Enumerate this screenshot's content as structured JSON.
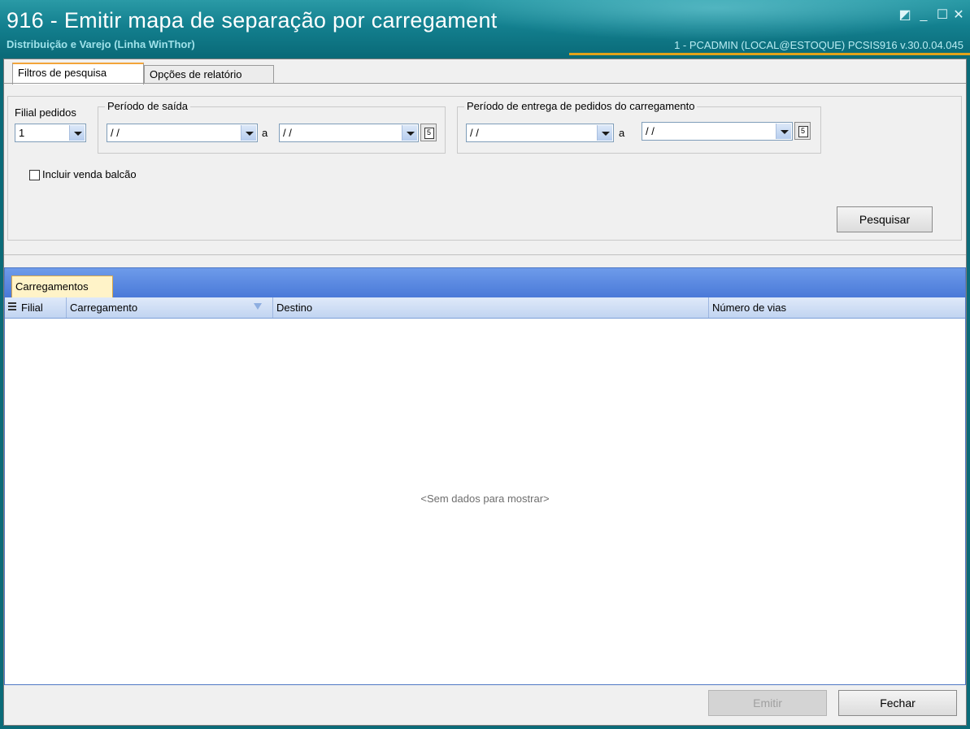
{
  "window": {
    "title": "916 - Emitir mapa de separação por carregament",
    "subtitle": "Distribuição e Varejo (Linha WinThor)",
    "user_info": "1 - PCADMIN (LOCAL@ESTOQUE)   PCSIS916  v.30.0.04.045",
    "accent_color": "#e3a21a"
  },
  "tabs": [
    {
      "label": "Filtros de pesquisa",
      "active": true
    },
    {
      "label": "Opções de relatório",
      "active": false
    }
  ],
  "filters": {
    "filial_label": "Filial pedidos",
    "filial_value": "1",
    "periodo_saida_label": "Período de saída",
    "periodo_saida_de": "/ /",
    "periodo_saida_ate": "/ /",
    "separator_a": "a",
    "periodo_entrega_label": "Período de entrega de pedidos do carregamento",
    "periodo_entrega_de": "/ /",
    "periodo_entrega_ate": "/ /",
    "incluir_venda_balcao_label": "Incluir venda balcão",
    "incluir_venda_balcao_checked": false,
    "search_button": "Pesquisar"
  },
  "grid": {
    "tab_label": "Carregamentos",
    "columns": [
      "Filial",
      "Carregamento",
      "Destino",
      "Número de vias"
    ],
    "empty_text": "<Sem dados para mostrar>",
    "rows": []
  },
  "footer": {
    "emitir_button": "Emitir",
    "fechar_button": "Fechar"
  }
}
